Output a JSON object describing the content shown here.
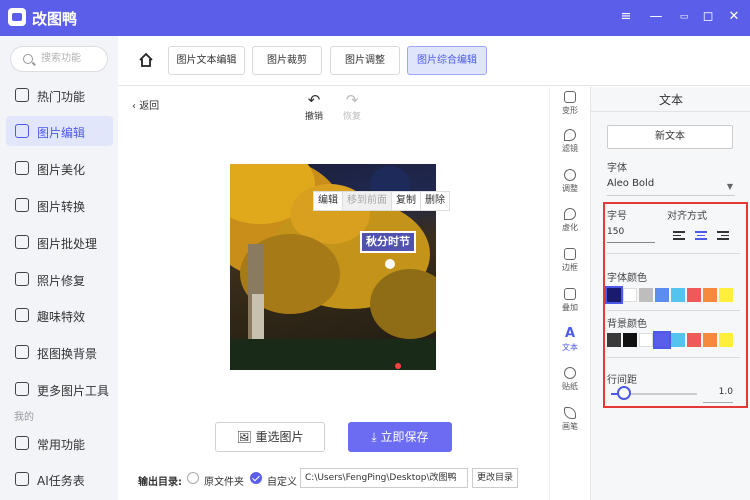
{
  "app": {
    "title": "改图鸭"
  },
  "window": {
    "min": "—",
    "restore": "☐",
    "max": "◻",
    "close": "✕"
  },
  "search": {
    "placeholder": "搜索功能"
  },
  "sidebar": {
    "items": [
      {
        "label": "热门功能"
      },
      {
        "label": "图片编辑",
        "active": true
      },
      {
        "label": "图片美化"
      },
      {
        "label": "图片转换"
      },
      {
        "label": "图片批处理"
      },
      {
        "label": "照片修复"
      },
      {
        "label": "趣味特效"
      },
      {
        "label": "抠图换背景"
      },
      {
        "label": "更多图片工具"
      }
    ],
    "section": "我的",
    "my_items": [
      {
        "label": "常用功能"
      },
      {
        "label": "AI任务表"
      }
    ]
  },
  "tabs": [
    {
      "label": "图片文本编辑"
    },
    {
      "label": "图片裁剪"
    },
    {
      "label": "图片调整"
    },
    {
      "label": "图片综合编辑",
      "active": true
    }
  ],
  "canvas": {
    "back": "返回",
    "undo": "撤销",
    "redo": "恢复",
    "context_menu": [
      "编辑",
      "移到前面",
      "复制",
      "删除"
    ],
    "text_layer": "秋分时节"
  },
  "actions": {
    "reselect": "重选图片",
    "save": "立即保存"
  },
  "output": {
    "label": "输出目录:",
    "original_folder": "原文件夹",
    "custom": "自定义",
    "path": "C:\\Users\\FengPing\\Desktop\\改图鸭",
    "change": "更改目录"
  },
  "tools": [
    {
      "label": "变形"
    },
    {
      "label": "滤镜"
    },
    {
      "label": "调整"
    },
    {
      "label": "虚化"
    },
    {
      "label": "边框"
    },
    {
      "label": "叠加"
    },
    {
      "label": "文本",
      "active": true
    },
    {
      "label": "贴纸"
    },
    {
      "label": "画笔"
    }
  ],
  "panel": {
    "title": "文本",
    "new_text": "新文本",
    "font_label": "字体",
    "font_value": "Aleo Bold",
    "size_label": "字号",
    "size_value": "150",
    "align_label": "对齐方式",
    "font_color_label": "字体颜色",
    "bg_color_label": "背景颜色",
    "line_spacing_label": "行间距",
    "line_spacing_value": "1.0",
    "line_spacing_fraction": 0.15,
    "font_colors": [
      "#1a1a6e",
      "#ffffff",
      "#bdbdbd",
      "#5b8def",
      "#55c3f0",
      "#ee5a5a",
      "#f58a3c",
      "#ffee3b"
    ],
    "bg_colors": [
      "#3a3a3a",
      "#111111",
      "#ffffff",
      "#5b5ee8",
      "#55c3f0",
      "#ee5a5a",
      "#f58a3c",
      "#ffee3b"
    ],
    "accent": "#4d5ae8"
  }
}
